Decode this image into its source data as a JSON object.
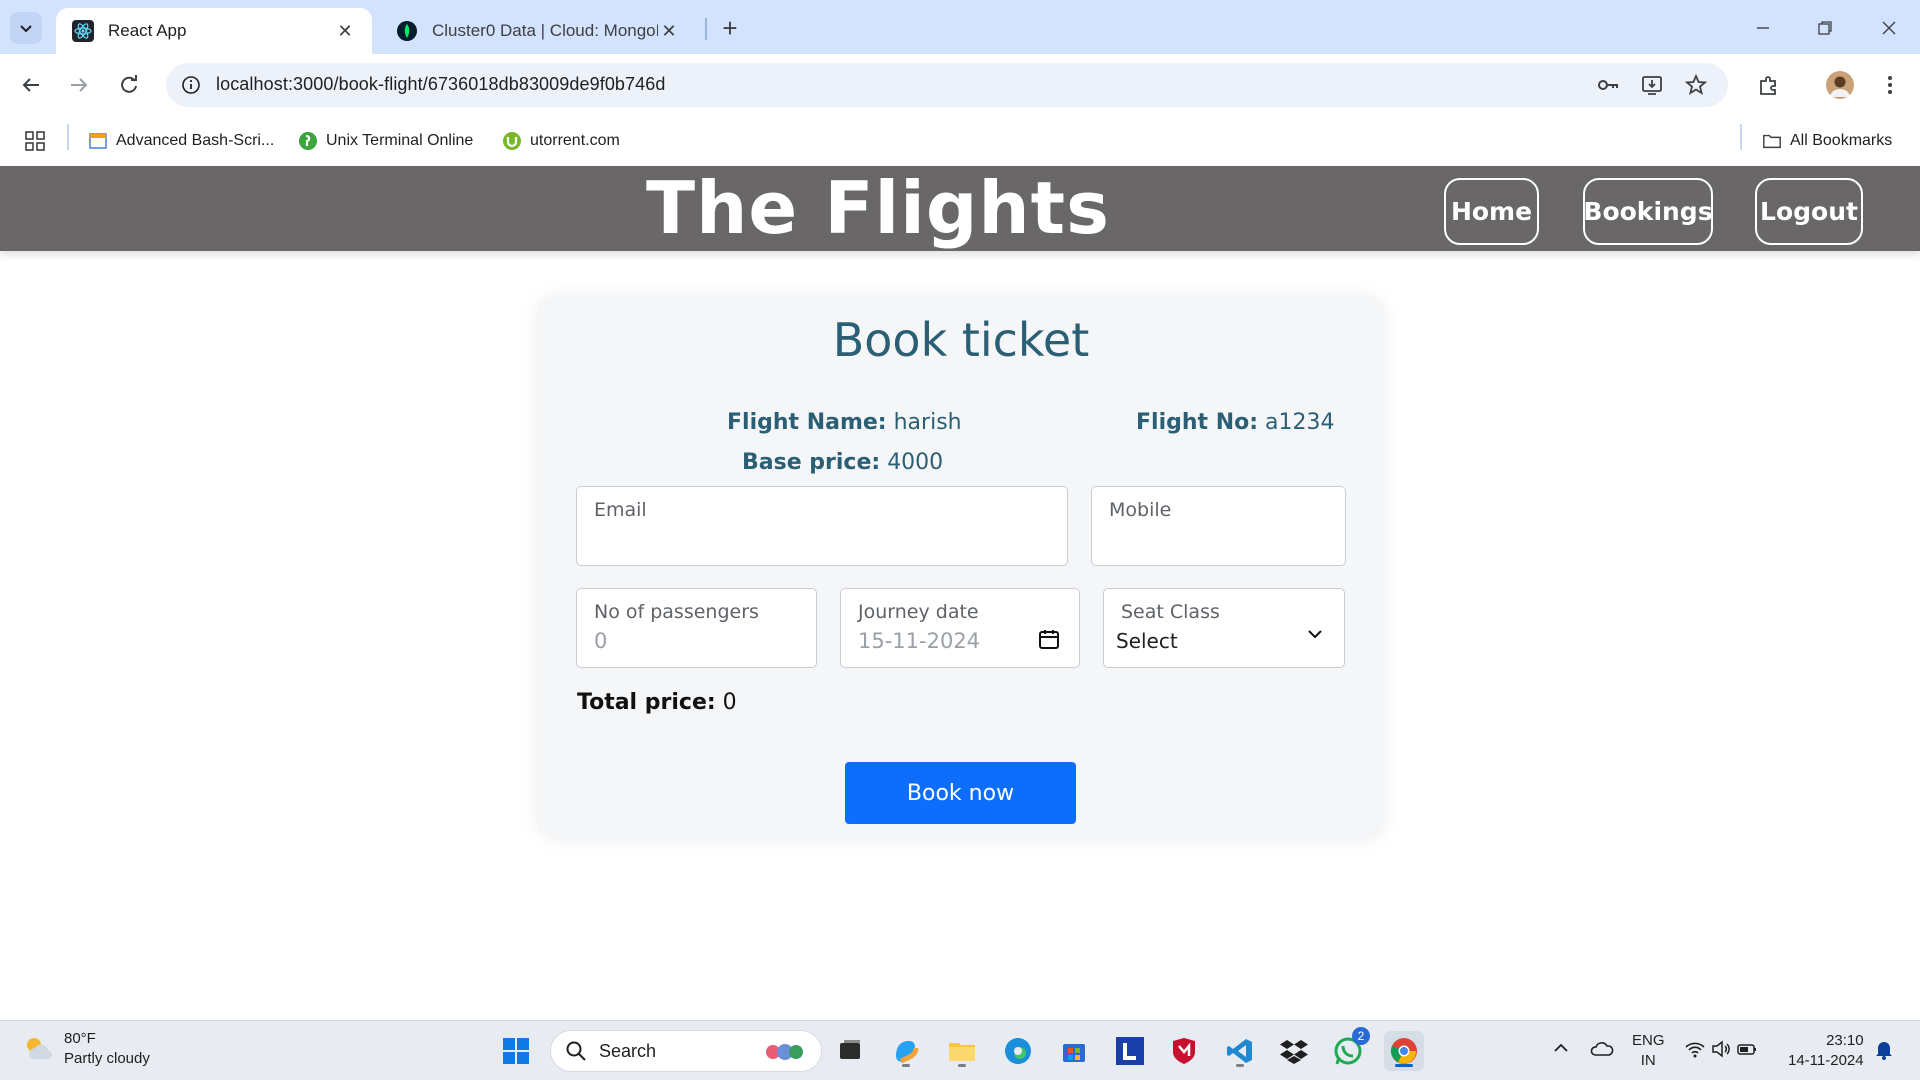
{
  "browser": {
    "tabs": [
      {
        "title": "React App",
        "icon": "react-icon",
        "active": true
      },
      {
        "title": "Cluster0 Data | Cloud: MongoDB",
        "icon": "mongodb-leaf-icon",
        "active": false
      }
    ],
    "url": "localhost:3000/book-flight/6736018db83009de9f0b746d",
    "bookmarks": [
      {
        "label": "Advanced Bash-Scri...",
        "icon": "page-icon"
      },
      {
        "label": "Unix Terminal Online",
        "icon": "terminal-icon"
      },
      {
        "label": "utorrent.com",
        "icon": "utorrent-icon"
      }
    ],
    "all_bookmarks_label": "All Bookmarks"
  },
  "app": {
    "brand": "The Flights",
    "nav": {
      "home": "Home",
      "bookings": "Bookings",
      "logout": "Logout"
    }
  },
  "booking": {
    "title": "Book ticket",
    "flight_name_label": "Flight Name:",
    "flight_name": "harish",
    "flight_no_label": "Flight No:",
    "flight_no": "a1234",
    "base_price_label": "Base price:",
    "base_price": "4000",
    "email_label": "Email",
    "mobile_label": "Mobile",
    "passengers_label": "No of passengers",
    "passengers_value": "0",
    "date_label": "Journey date",
    "date_value": "15-11-2024",
    "seat_label": "Seat Class",
    "seat_value": "Select",
    "total_label": "Total price:",
    "total_value": "0",
    "book_button": "Book now",
    "accent_color": "#0d6efd",
    "heading_color": "#2b5f75"
  },
  "taskbar": {
    "weather_temp": "80°F",
    "weather_desc": "Partly cloudy",
    "search_label": "Search",
    "lang_line1": "ENG",
    "lang_line2": "IN",
    "time": "23:10",
    "date": "14-11-2024",
    "notification_badge": "2"
  }
}
